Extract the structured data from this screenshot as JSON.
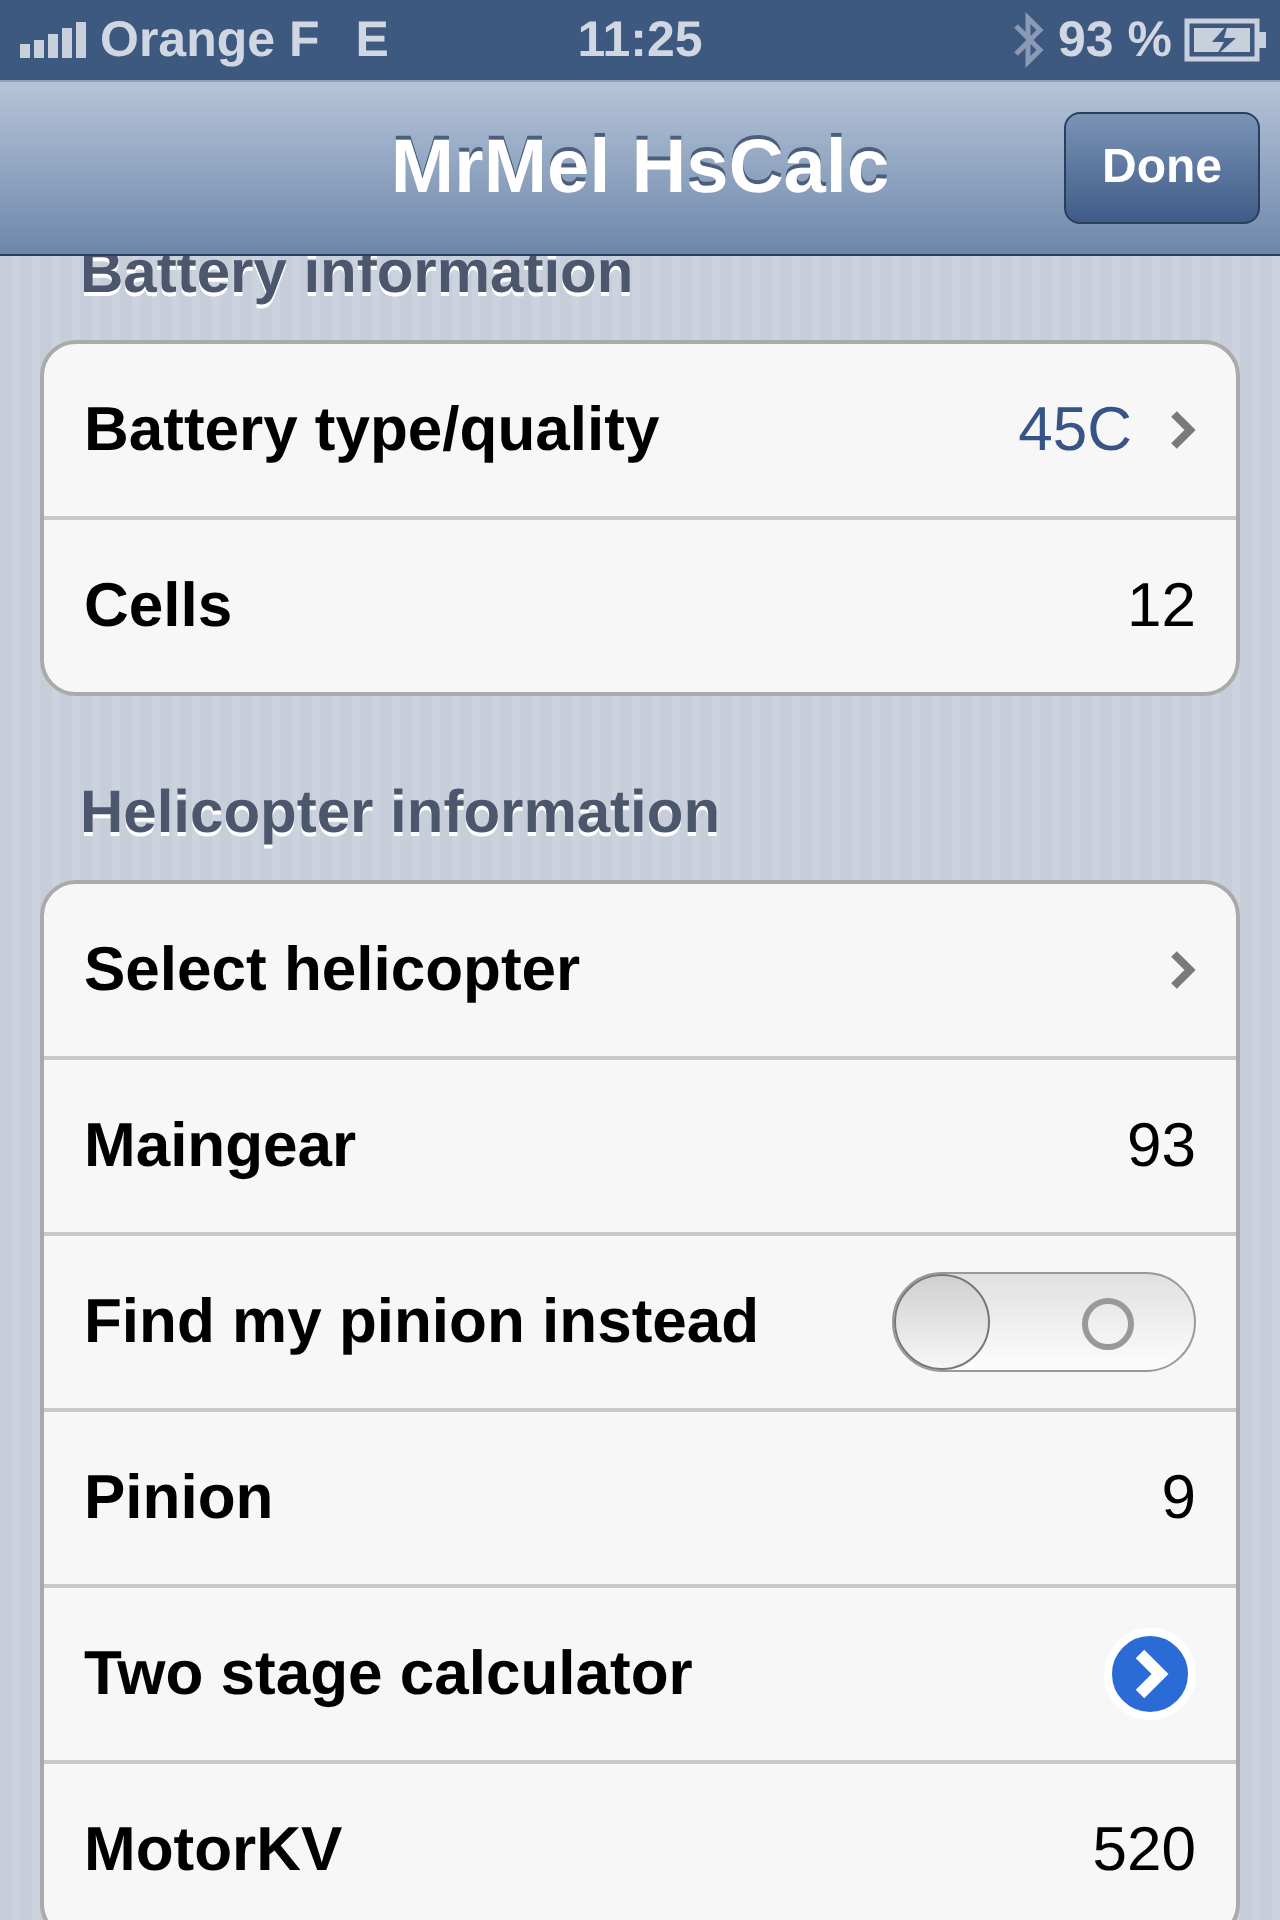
{
  "status_bar": {
    "carrier": "Orange F",
    "network": "E",
    "time": "11:25",
    "battery": "93 %"
  },
  "nav_bar": {
    "title": "MrMel HsCalc",
    "done_button": "Done"
  },
  "sections": [
    {
      "header": "Battery information",
      "rows": [
        {
          "kind": "disclosure",
          "label": "Battery type/quality",
          "value": "45C"
        },
        {
          "kind": "value",
          "label": "Cells",
          "value": "12"
        }
      ]
    },
    {
      "header": "Helicopter information",
      "rows": [
        {
          "kind": "disclosure",
          "label": "Select helicopter"
        },
        {
          "kind": "value",
          "label": "Maingear",
          "value": "93"
        },
        {
          "kind": "toggle",
          "label": "Find my pinion instead",
          "on": false
        },
        {
          "kind": "value",
          "label": "Pinion",
          "value": "9"
        },
        {
          "kind": "detail",
          "label": "Two stage calculator"
        },
        {
          "kind": "value",
          "label": "MotorKV",
          "value": "520"
        }
      ]
    }
  ]
}
